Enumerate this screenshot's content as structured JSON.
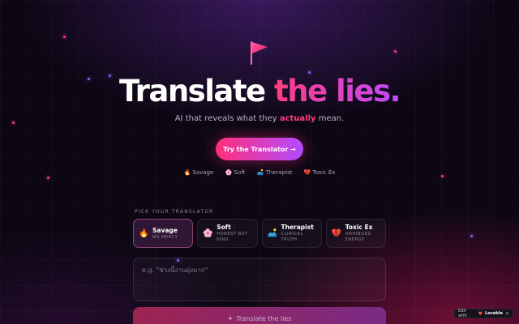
{
  "hero": {
    "title_part1": "Translate",
    "title_part2": "the lies.",
    "subtitle_before": "AI that reveals what they",
    "subtitle_highlight": "actually",
    "subtitle_after": "mean.",
    "cta_label": "Try the Translator →",
    "flag_icon": "flag-icon",
    "accent_color": "#ff3d7f",
    "accent_color_2": "#b34bff"
  },
  "modes_row": [
    {
      "emoji": "🔥",
      "label": "Savage"
    },
    {
      "emoji": "🌸",
      "label": "Soft"
    },
    {
      "emoji": "🛋️",
      "label": "Therapist"
    },
    {
      "emoji": "💔",
      "label": "Toxic Ex"
    }
  ],
  "picker": {
    "label": "PICK YOUR TRANSLATOR",
    "cards": [
      {
        "emoji": "🔥",
        "name": "Savage",
        "desc": "NO MERCY",
        "active": true
      },
      {
        "emoji": "🌸",
        "name": "Soft",
        "desc": "HONEST BUT KIND",
        "active": false
      },
      {
        "emoji": "🛋️",
        "name": "Therapist",
        "desc": "CLINICAL TRUTH",
        "active": false
      },
      {
        "emoji": "💔",
        "name": "Toxic Ex",
        "desc": "UNHINGED ENERGY",
        "active": false
      }
    ]
  },
  "input": {
    "value": "",
    "placeholder": "e.g. \"ช่วงนี้งานยุ่งมาก\""
  },
  "translate_button": {
    "icon": "sparkle-icon",
    "label": "Translate the lies"
  },
  "badge": {
    "text": "Edit with",
    "brand": "Lovable",
    "close": "✕"
  }
}
